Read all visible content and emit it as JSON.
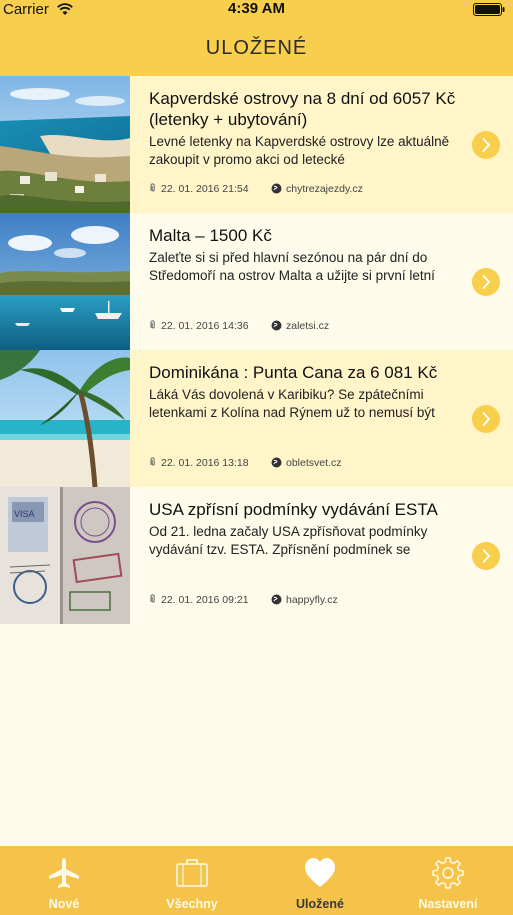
{
  "status": {
    "carrier": "Carrier",
    "time": "4:39 AM"
  },
  "nav": {
    "title": "ULOŽENÉ"
  },
  "articles": [
    {
      "title": "Kapverdské ostrovy na 8 dní od 6057 Kč (letenky + ubytování)",
      "description": "Levné letenky na Kapverdské ostrovy lze aktuálně zakoupit v promo akci od letecké",
      "date": "22. 01. 2016 21:54",
      "source": "chytrezajezdy.cz",
      "image": "coastal-town-photo"
    },
    {
      "title": "Malta – 1500 Kč",
      "description": "Zaleťte si si před hlavní sezónou na pár dní do Středomoří na ostrov Malta a užijte si první letní",
      "date": "22. 01. 2016 14:36",
      "source": "zaletsi.cz",
      "image": "harbor-boats-photo"
    },
    {
      "title": "Dominikána : Punta Cana za 6 081 Kč",
      "description": "Láká Vás dovolená v Karibiku? Se zpátečními letenkami z Kolína nad Rýnem už to nemusí být",
      "date": "22. 01. 2016 13:18",
      "source": "obletsvet.cz",
      "image": "palm-beach-photo"
    },
    {
      "title": "USA zpřísní podmínky vydávání ESTA",
      "description": "Od 21. ledna začaly USA zpřísňovat podmínky vydávání tzv. ESTA. Zpřísnění podmínek se",
      "date": "22. 01. 2016 09:21",
      "source": "happyfly.cz",
      "image": "passport-stamps-photo"
    }
  ],
  "tabs": [
    {
      "label": "Nové",
      "icon": "airplane-icon"
    },
    {
      "label": "Všechny",
      "icon": "suitcase-icon"
    },
    {
      "label": "Uložené",
      "icon": "heart-icon"
    },
    {
      "label": "Nastavení",
      "icon": "gear-icon"
    }
  ],
  "colors": {
    "accent": "#f7cf4d",
    "tabbar": "#f5c24a",
    "row_tint": "#fff5c9",
    "background": "#fffbea"
  }
}
